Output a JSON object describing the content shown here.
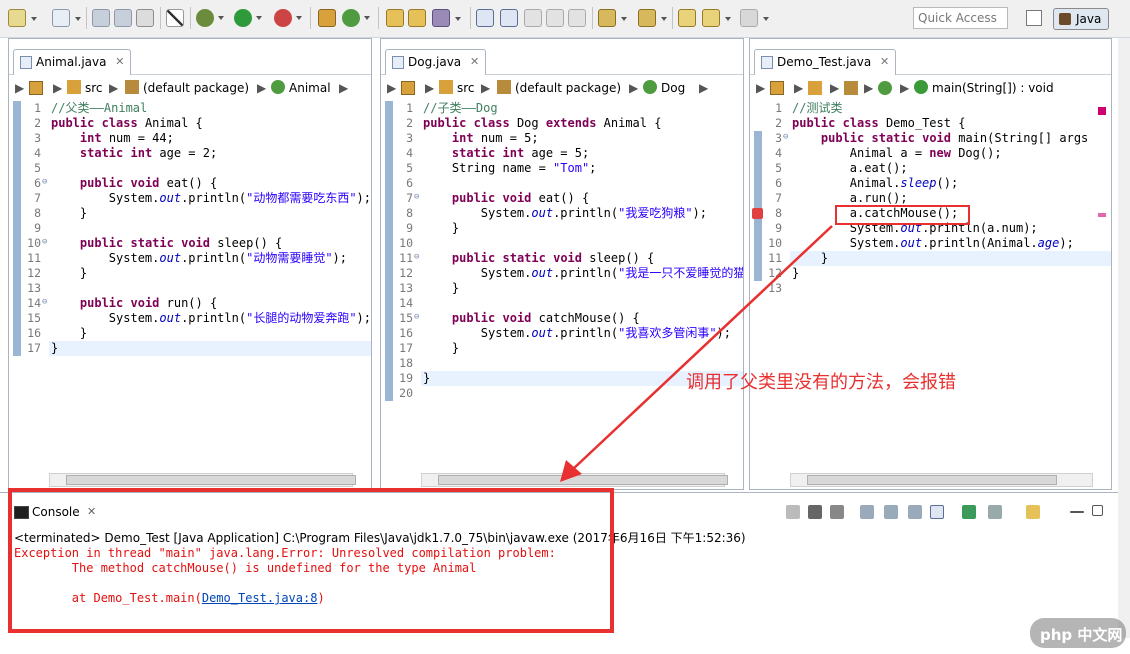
{
  "toolbar": {
    "quick_access_placeholder": "Quick Access",
    "perspective_label": "Java"
  },
  "editors": [
    {
      "tab_label": "Animal.java",
      "breadcrumb": [
        "src",
        "(default package)",
        "Animal"
      ],
      "lines": [
        {
          "n": "1",
          "t": "//父类——Animal"
        },
        {
          "n": "2",
          "t": "public class Animal {"
        },
        {
          "n": "3",
          "t": "    int num = 44;"
        },
        {
          "n": "4",
          "t": "    static int age = 2;"
        },
        {
          "n": "5",
          "t": ""
        },
        {
          "n": "6",
          "t": "    public void eat() {"
        },
        {
          "n": "7",
          "t": "        System.out.println(\"动物都需要吃东西\");"
        },
        {
          "n": "8",
          "t": "    }"
        },
        {
          "n": "9",
          "t": ""
        },
        {
          "n": "10",
          "t": "    public static void sleep() {"
        },
        {
          "n": "11",
          "t": "        System.out.println(\"动物需要睡觉\");"
        },
        {
          "n": "12",
          "t": "    }"
        },
        {
          "n": "13",
          "t": ""
        },
        {
          "n": "14",
          "t": "    public void run() {"
        },
        {
          "n": "15",
          "t": "        System.out.println(\"长腿的动物爱奔跑\");"
        },
        {
          "n": "16",
          "t": "    }"
        },
        {
          "n": "17",
          "t": "}"
        }
      ]
    },
    {
      "tab_label": "Dog.java",
      "breadcrumb": [
        "src",
        "(default package)",
        "Dog"
      ],
      "lines": [
        {
          "n": "1",
          "t": "//子类——Dog"
        },
        {
          "n": "2",
          "t": "public class Dog extends Animal {"
        },
        {
          "n": "3",
          "t": "    int num = 5;"
        },
        {
          "n": "4",
          "t": "    static int age = 5;"
        },
        {
          "n": "5",
          "t": "    String name = \"Tom\";"
        },
        {
          "n": "6",
          "t": ""
        },
        {
          "n": "7",
          "t": "    public void eat() {"
        },
        {
          "n": "8",
          "t": "        System.out.println(\"我爱吃狗粮\");"
        },
        {
          "n": "9",
          "t": "    }"
        },
        {
          "n": "10",
          "t": ""
        },
        {
          "n": "11",
          "t": "    public static void sleep() {"
        },
        {
          "n": "12",
          "t": "        System.out.println(\"我是一只不爱睡觉的猫\");"
        },
        {
          "n": "13",
          "t": "    }"
        },
        {
          "n": "14",
          "t": ""
        },
        {
          "n": "15",
          "t": "    public void catchMouse() {"
        },
        {
          "n": "16",
          "t": "        System.out.println(\"我喜欢多管闲事\");"
        },
        {
          "n": "17",
          "t": "    }"
        },
        {
          "n": "18",
          "t": ""
        },
        {
          "n": "19",
          "t": "}"
        },
        {
          "n": "20",
          "t": ""
        }
      ]
    },
    {
      "tab_label": "Demo_Test.java",
      "breadcrumb": [
        "main(String[]) : void"
      ],
      "lines": [
        {
          "n": "1",
          "t": "//测试类"
        },
        {
          "n": "2",
          "t": "public class Demo_Test {"
        },
        {
          "n": "3",
          "t": "    public static void main(String[] args"
        },
        {
          "n": "4",
          "t": "        Animal a = new Dog();"
        },
        {
          "n": "5",
          "t": "        a.eat();"
        },
        {
          "n": "6",
          "t": "        Animal.sleep();"
        },
        {
          "n": "7",
          "t": "        a.run();"
        },
        {
          "n": "8",
          "t": "        a.catchMouse();"
        },
        {
          "n": "9",
          "t": "        System.out.println(a.num);"
        },
        {
          "n": "10",
          "t": "        System.out.println(Animal.age);"
        },
        {
          "n": "11",
          "t": "    }"
        },
        {
          "n": "12",
          "t": "}"
        },
        {
          "n": "13",
          "t": ""
        }
      ]
    }
  ],
  "console": {
    "tab_label": "Console",
    "terminated_line": "<terminated> Demo_Test [Java Application] C:\\Program Files\\Java\\jdk1.7.0_75\\bin\\javaw.exe (2017年6月16日 下午1:52:36)",
    "error_line1": "Exception in thread \"main\" java.lang.Error: Unresolved compilation problem: ",
    "error_line2": "\tThe method catchMouse() is undefined for the type Animal",
    "error_line3_prefix": "\tat Demo_Test.main(",
    "error_link": "Demo_Test.java:8",
    "error_line3_suffix": ")"
  },
  "annotation": {
    "text": "调用了父类里没有的方法，会报错",
    "color": "#e83030"
  },
  "watermark": "php 中文网"
}
